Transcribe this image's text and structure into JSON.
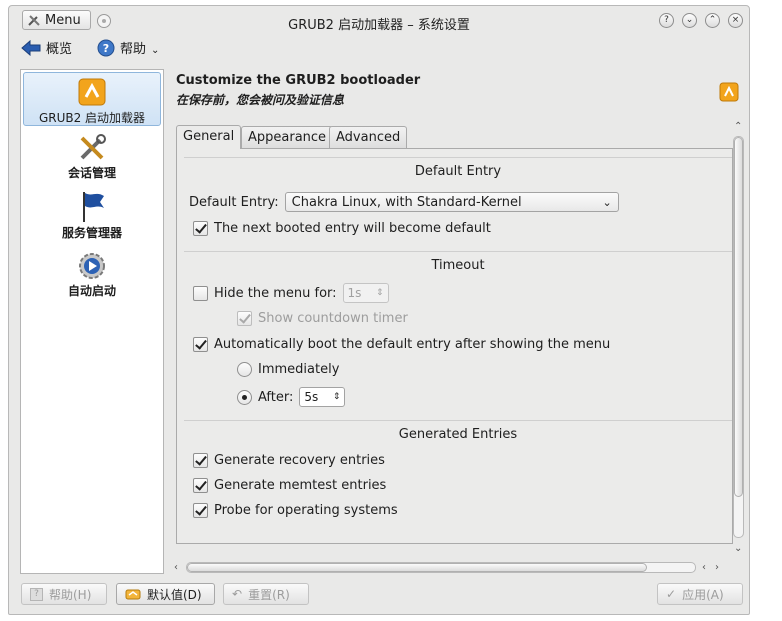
{
  "window": {
    "title": "GRUB2 启动加载器 – 系统设置",
    "menu_label": "Menu",
    "controls": [
      "?",
      "⌄",
      "⌃",
      "×"
    ]
  },
  "toolbar": {
    "overview_label": "概览",
    "help_label": "帮助"
  },
  "sidebar": {
    "items": [
      {
        "label": "GRUB2 启动加载器",
        "icon": "grub-icon",
        "selected": true
      },
      {
        "label": "会话管理",
        "icon": "tools-icon",
        "selected": false
      },
      {
        "label": "服务管理器",
        "icon": "flag-icon",
        "selected": false
      },
      {
        "label": "自动启动",
        "icon": "gear-play-icon",
        "selected": false
      }
    ]
  },
  "header": {
    "title": "Customize the GRUB2 bootloader",
    "subtitle": "在保存前，您会被问及验证信息"
  },
  "tabs": [
    {
      "label": "General",
      "active": true
    },
    {
      "label": "Appearance",
      "active": false
    },
    {
      "label": "Advanced",
      "active": false
    }
  ],
  "default_entry": {
    "group_title": "Default Entry",
    "label": "Default Entry:",
    "selected": "Chakra Linux, with Standard-Kernel",
    "next_booted_label": "The next booted entry will become default",
    "next_booted_checked": true
  },
  "timeout": {
    "group_title": "Timeout",
    "hide_menu_label": "Hide the menu for:",
    "hide_menu_checked": false,
    "hide_menu_value": "1s",
    "show_countdown_label": "Show countdown timer",
    "show_countdown_checked": true,
    "auto_boot_label": "Automatically boot the default entry after showing the menu",
    "auto_boot_checked": true,
    "immediately_label": "Immediately",
    "after_label": "After:",
    "after_value": "5s",
    "selected_option": "After"
  },
  "generated": {
    "group_title": "Generated Entries",
    "recovery_label": "Generate recovery entries",
    "memtest_label": "Generate memtest entries",
    "probe_label": "Probe for operating systems"
  },
  "buttons": {
    "help": "帮助(H)",
    "defaults": "默认值(D)",
    "reset": "重置(R)",
    "apply": "应用(A)"
  },
  "colors": {
    "window_bg": "#e9e9e8",
    "selection": "#cfe2f5",
    "accent": "#f0a020"
  }
}
